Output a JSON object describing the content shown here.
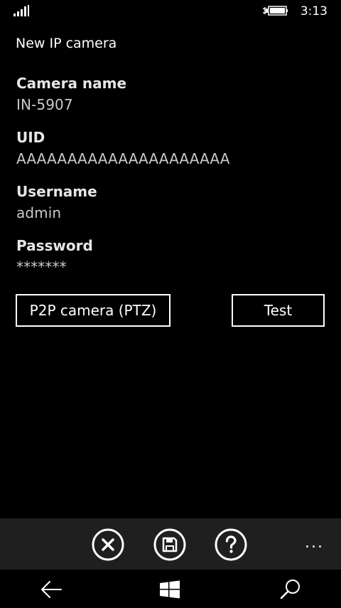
{
  "status_bar": {
    "time": "3:13",
    "icons": [
      "signal-strength-icon",
      "battery-charging-icon"
    ]
  },
  "app": {
    "title": "New IP camera"
  },
  "form": {
    "camera_name": {
      "label": "Camera name",
      "value": "IN-5907"
    },
    "uid": {
      "label": "UID",
      "value": "AAAAAAAAAAAAAAAAAAAAA"
    },
    "username": {
      "label": "Username",
      "value": "admin"
    },
    "password": {
      "label": "Password",
      "value": "*******"
    }
  },
  "buttons": {
    "camera_type_label": "P2P camera (PTZ)",
    "test_label": "Test"
  },
  "app_bar": {
    "icons": [
      "cancel-icon",
      "save-icon",
      "help-icon"
    ],
    "more_label": "..."
  },
  "nav_bar": {
    "icons": [
      "back-arrow-icon",
      "windows-start-icon",
      "search-icon"
    ]
  },
  "colors": {
    "background": "#000000",
    "app_bar": "#1f1f1f",
    "label": "#e6e6e6",
    "value": "#c9c9c9"
  }
}
